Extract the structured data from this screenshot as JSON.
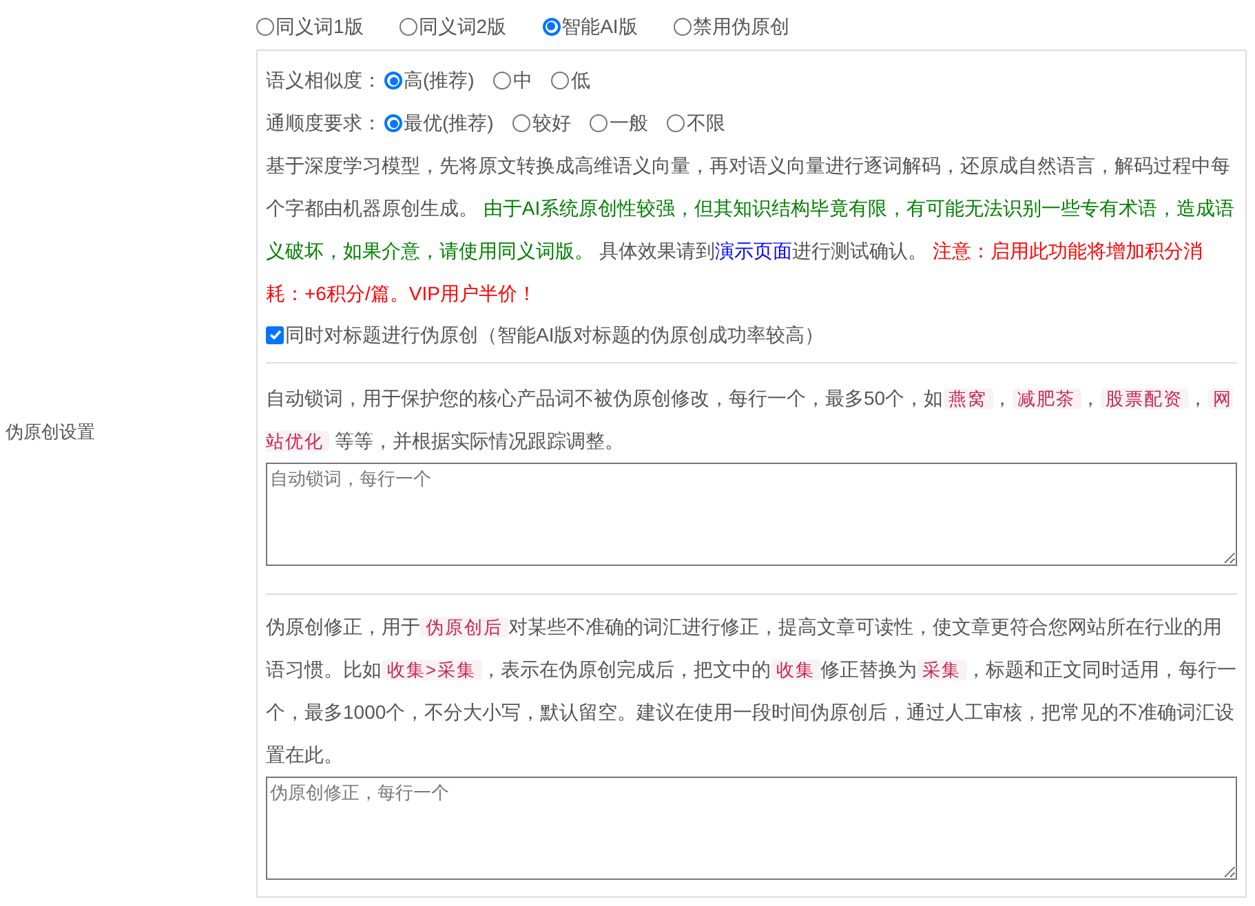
{
  "mode_options": [
    {
      "label": "同义词1版",
      "selected": false
    },
    {
      "label": "同义词2版",
      "selected": false
    },
    {
      "label": "智能AI版",
      "selected": true
    },
    {
      "label": "禁用伪原创",
      "selected": false
    }
  ],
  "ai_settings": {
    "similarity": {
      "label": "语义相似度：",
      "options": [
        {
          "label": "高(推荐)",
          "selected": true
        },
        {
          "label": "中",
          "selected": false
        },
        {
          "label": "低",
          "selected": false
        }
      ]
    },
    "fluency": {
      "label": "通顺度要求：",
      "options": [
        {
          "label": "最优(推荐)",
          "selected": true
        },
        {
          "label": "较好",
          "selected": false
        },
        {
          "label": "一般",
          "selected": false
        },
        {
          "label": "不限",
          "selected": false
        }
      ]
    },
    "description": [
      {
        "kind": "plain",
        "text": "基于深度学习模型，先将原文转换成高维语义向量，再对语义向量进行逐词解码，还原成自然语言，解码过程中每个字都由机器原创生成。 "
      },
      {
        "kind": "green",
        "text": "由于AI系统原创性较强，但其知识结构毕竟有限，有可能无法识别一些专有术语，造成语义破坏，如果介意，请使用同义词版。"
      },
      {
        "kind": "plain",
        "text": " 具体效果请到"
      },
      {
        "kind": "link",
        "text": "演示页面"
      },
      {
        "kind": "plain",
        "text": "进行测试确认。 "
      },
      {
        "kind": "red",
        "text": "注意：启用此功能将增加积分消耗：+6积分/篇。VIP用户半价！"
      }
    ],
    "title_option": {
      "label": "同时对标题进行伪原创（智能AI版对标题的伪原创成功率较高）",
      "checked": true
    }
  },
  "section_label": "伪原创设置",
  "lock_words": {
    "description": [
      {
        "kind": "plain",
        "text": "自动锁词，用于保护您的核心产品词不被伪原创修改，每行一个，最多50个，如"
      },
      {
        "kind": "code",
        "text": "燕窝"
      },
      {
        "kind": "plain",
        "text": "，"
      },
      {
        "kind": "code",
        "text": "减肥茶"
      },
      {
        "kind": "plain",
        "text": "，"
      },
      {
        "kind": "code",
        "text": "股票配资"
      },
      {
        "kind": "plain",
        "text": "，"
      },
      {
        "kind": "code",
        "text": "网站优化"
      },
      {
        "kind": "plain",
        "text": " 等等，并根据实际情况跟踪调整。"
      }
    ],
    "placeholder": "自动锁词，每行一个"
  },
  "corrections": {
    "description": [
      {
        "kind": "plain",
        "text": "伪原创修正，用于"
      },
      {
        "kind": "code",
        "text": "伪原创后"
      },
      {
        "kind": "plain",
        "text": "对某些不准确的词汇进行修正，提高文章可读性，使文章更符合您网站所在行业的用语习惯。比如"
      },
      {
        "kind": "code",
        "text": "收集>采集"
      },
      {
        "kind": "plain",
        "text": "，表示在伪原创完成后，把文中的"
      },
      {
        "kind": "code",
        "text": "收集"
      },
      {
        "kind": "plain",
        "text": "修正替换为"
      },
      {
        "kind": "code",
        "text": "采集"
      },
      {
        "kind": "plain",
        "text": "，标题和正文同时适用，每行一个，最多1000个，不分大小写，默认留空。建议在使用一段时间伪原创后，通过人工审核，把常见的不准确词汇设置在此。"
      }
    ],
    "placeholder": "伪原创修正，每行一个"
  }
}
